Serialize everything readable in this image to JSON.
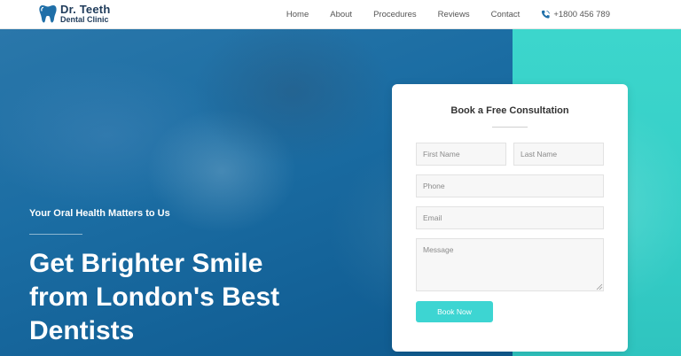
{
  "logo": {
    "title": "Dr. Teeth",
    "subtitle": "Dental Clinic",
    "icon": "tooth-icon"
  },
  "nav": {
    "items": [
      {
        "label": "Home"
      },
      {
        "label": "About"
      },
      {
        "label": "Procedures"
      },
      {
        "label": "Reviews"
      },
      {
        "label": "Contact"
      }
    ],
    "phone": {
      "icon": "phone-icon",
      "number": "+1800 456 789"
    }
  },
  "hero": {
    "tagline": "Your Oral Health Matters to Us",
    "headline_lines": [
      "Get Brighter Smile",
      "from London's Best",
      "Dentists"
    ]
  },
  "form": {
    "title": "Book a Free Consultation",
    "first_name_placeholder": "First Name",
    "last_name_placeholder": "Last Name",
    "phone_placeholder": "Phone",
    "email_placeholder": "Email",
    "message_placeholder": "Message",
    "submit_label": "Book Now"
  },
  "colors": {
    "brand_dark": "#1f3b5a",
    "hero_blue": "#1b6da3",
    "hero_teal": "#35cec7",
    "button_teal": "#3dd5d2"
  }
}
